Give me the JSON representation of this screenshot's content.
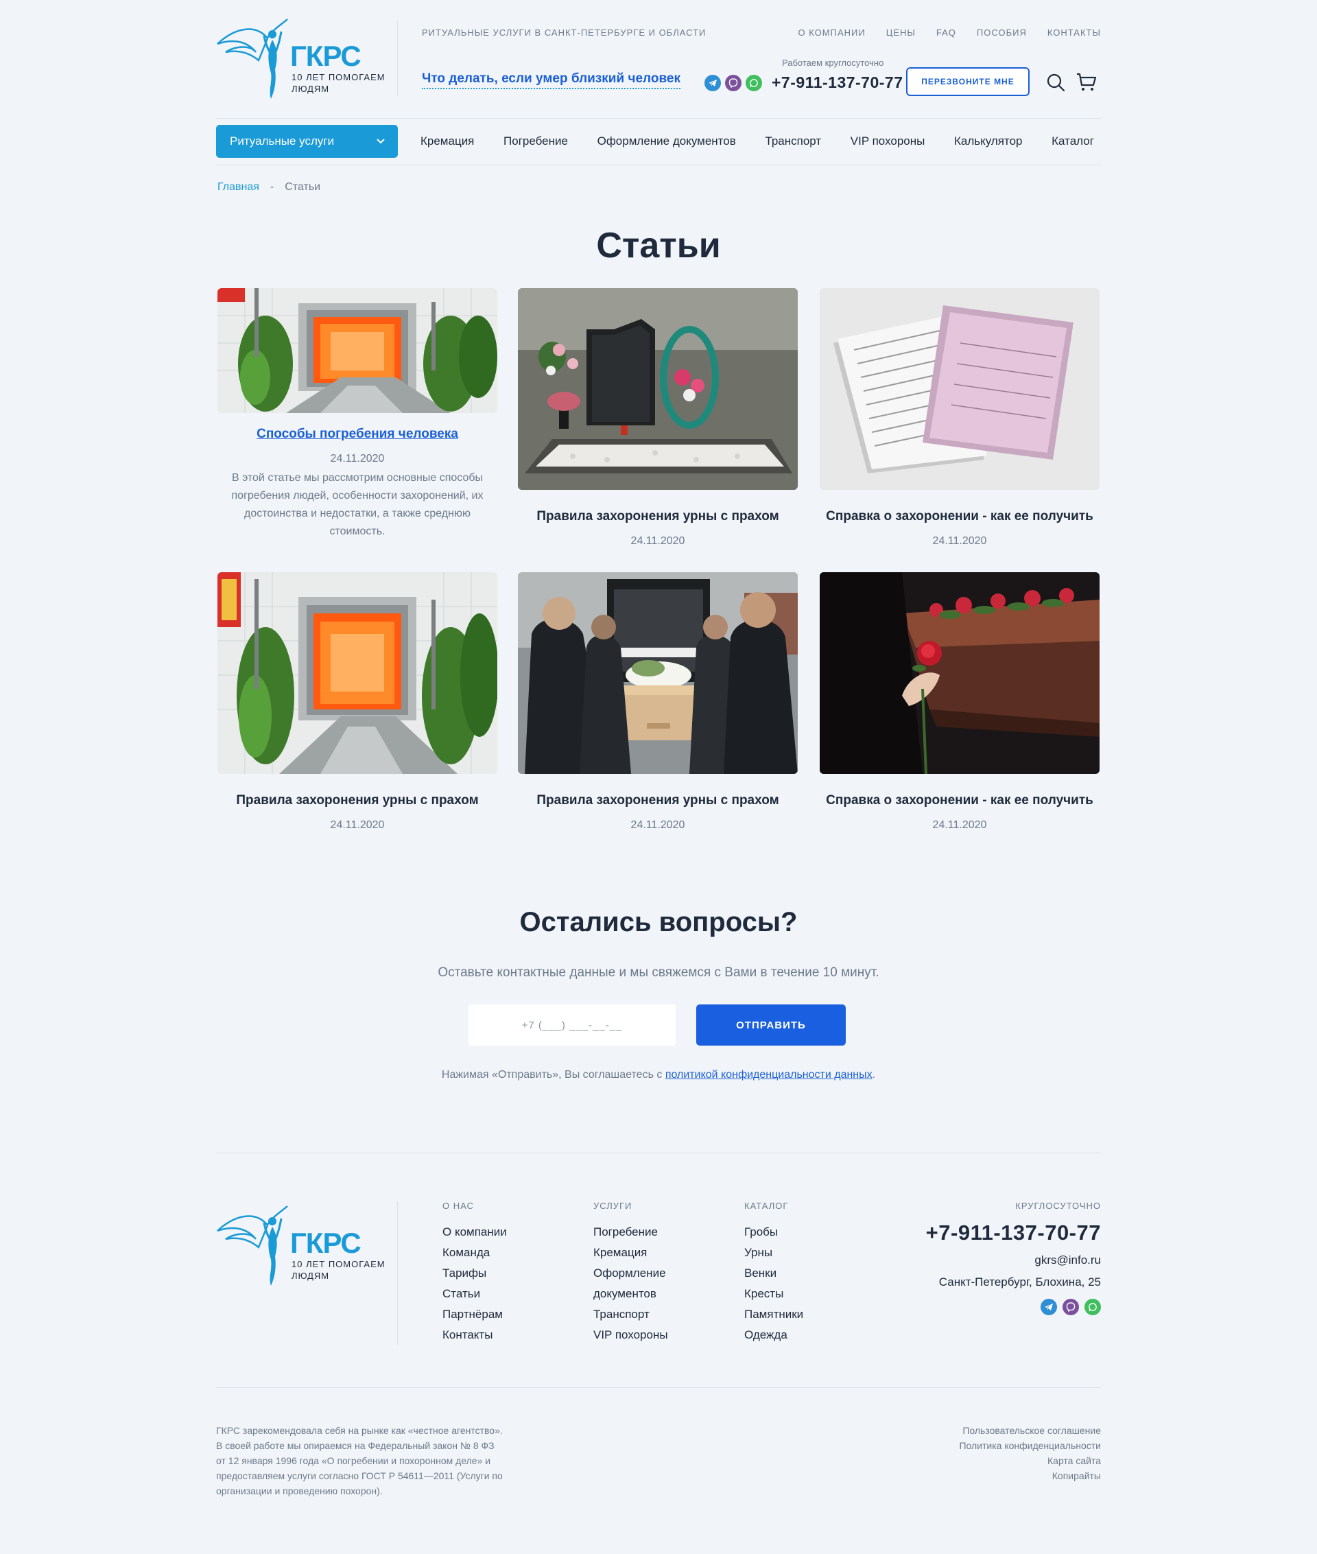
{
  "header": {
    "brand": "ГКРС",
    "tagline": "10 ЛЕТ ПОМОГАЕМ ЛЮДЯМ",
    "region": "Ритуальные услуги в Санкт-Петербурге и области",
    "what_to_do": "Что делать, если умер близкий человек",
    "top_menu": [
      "О компании",
      "Цены",
      "FAQ",
      "Пособия",
      "Контакты"
    ],
    "working_hours": "Работаем круглосуточно",
    "phone": "+7-911-137-70-77",
    "callback": "ПЕРЕЗВОНИТЕ МНЕ",
    "icons": {
      "search": "search-icon",
      "cart": "cart-icon"
    }
  },
  "nav": {
    "dropdown": "Ритуальные услуги",
    "items": [
      "Кремация",
      "Погребение",
      "Оформление документов",
      "Транспорт",
      "VIP похороны",
      "Калькулятор",
      "Каталог"
    ]
  },
  "breadcrumb": {
    "home": "Главная",
    "separator": "-",
    "current": "Статьи"
  },
  "page_title": "Статьи",
  "articles": [
    {
      "title": "Способы погребения человека",
      "date": "24.11.2020",
      "excerpt": "В этой статье мы рассмотрим основные способы погребения людей, особенности захоронений, их достоинства и недостатки, а также среднюю стоимость.",
      "image": "crematorium-furnace"
    },
    {
      "title": "Правила захоронения урны с прахом",
      "date": "24.11.2020",
      "image": "granite-headstone"
    },
    {
      "title": "Справка о захоронении - как ее получить",
      "date": "24.11.2020",
      "image": "burial-certificate"
    },
    {
      "title": "Правила захоронения урны с прахом",
      "date": "24.11.2020",
      "image": "crematorium-furnace"
    },
    {
      "title": "Правила захоронения урны с прахом",
      "date": "24.11.2020",
      "image": "pallbearers-coffin"
    },
    {
      "title": "Справка о захоронении - как ее получить",
      "date": "24.11.2020",
      "image": "rose-on-casket"
    }
  ],
  "questions": {
    "title": "Остались вопросы?",
    "subtitle": "Оставьте контактные данные и мы свяжемся с Вами в течение 10 минут.",
    "phone_placeholder": "+7 (___) ___-__-__",
    "send": "ОТПРАВИТЬ",
    "consent_prefix": "Нажимая «Отправить», Вы соглашаетесь с ",
    "consent_link": "политикой конфиденциальности данных",
    "consent_suffix": "."
  },
  "footer": {
    "about": {
      "head": "О нас",
      "items": [
        "О компании",
        "Команда",
        "Тарифы",
        "Статьи",
        "Партнёрам",
        "Контакты"
      ]
    },
    "services": {
      "head": "Услуги",
      "items": [
        "Погребение",
        "Кремация",
        "Оформление",
        "документов",
        "Транспорт",
        "VIP похороны"
      ]
    },
    "catalog": {
      "head": "Каталог",
      "items": [
        "Гробы",
        "Урны",
        "Венки",
        "Кресты",
        "Памятники",
        "Одежда"
      ]
    },
    "contact": {
      "head": "Круглосуточно",
      "phone": "+7-911-137-70-77",
      "email": "gkrs@info.ru",
      "address": "Санкт-Петербург, Блохина, 25"
    },
    "legal": "ГКРС зарекомендовала себя на рынке как «честное агентство». В своей работе мы опираемся на Федеральный закон № 8 ФЗ от 12 января 1996 года «О погребении и похоронном деле» и предоставляем услуги согласно ГОСТ Р 54611—2011 (Услуги по организации и проведению похорон).",
    "legal_links": [
      "Пользовательское соглашение",
      "Политика конфиденциальности",
      "Карта сайта",
      "Копирайты"
    ]
  },
  "colors": {
    "accent": "#1a9ad6",
    "primary": "#1a5fe0",
    "text": "#1f2a3c",
    "muted": "#6d7a8c",
    "background": "#f1f4f8",
    "telegram": "#2e8fd4",
    "viber": "#7b519d",
    "whatsapp": "#3fbf5e"
  }
}
